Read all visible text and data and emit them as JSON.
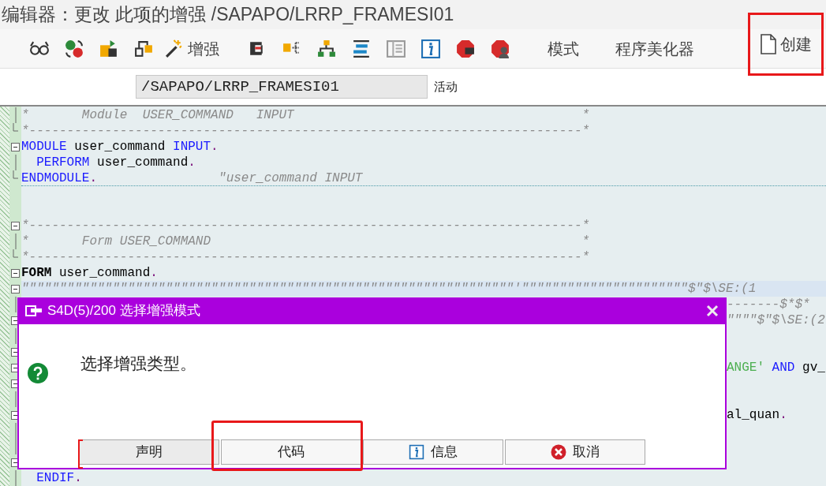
{
  "window": {
    "title": "编辑器：更改 此项的增强 /SAPAPO/LRRP_FRAMESI01"
  },
  "toolbar": [
    {
      "kind": "icon"
    },
    {
      "kind": "icon"
    },
    {
      "kind": "icon"
    },
    {
      "kind": "icon"
    },
    {
      "kind": "icon_text",
      "label": "增强"
    },
    {
      "kind": "icon"
    },
    {
      "kind": "icon"
    },
    {
      "kind": "icon"
    },
    {
      "kind": "icon"
    },
    {
      "kind": "icon"
    },
    {
      "kind": "icon"
    },
    {
      "kind": "icon"
    },
    {
      "kind": "icon"
    },
    {
      "kind": "text",
      "label": "模式"
    },
    {
      "kind": "text",
      "label": "程序美化器"
    },
    {
      "kind": "icon_text",
      "label": "创建",
      "highlighted": true
    }
  ],
  "object_field": {
    "value": "/SAPAPO/LRRP_FRAMESI01",
    "status": "活动"
  },
  "editor": {
    "lines": [
      {
        "fold": {
          "kind": "line"
        },
        "segments": [
          {
            "kind": "comment",
            "text": "*       Module  USER_COMMAND   INPUT                                      *"
          }
        ]
      },
      {
        "fold": {
          "kind": "end"
        },
        "segments": [
          {
            "kind": "comment",
            "text": "*-------------------------------------------------------------------------*"
          }
        ]
      },
      {
        "fold": {
          "kind": "open"
        },
        "segments": [
          {
            "kind": "keyword",
            "text": "MODULE"
          },
          {
            "kind": "plain",
            "text": " user_command "
          },
          {
            "kind": "keyword",
            "text": "INPUT"
          },
          {
            "kind": "punct",
            "text": "."
          }
        ]
      },
      {
        "fold": {
          "kind": "line"
        },
        "segments": [
          {
            "kind": "keyword",
            "text": "  PERFORM"
          },
          {
            "kind": "plain",
            "text": " user_command"
          },
          {
            "kind": "punct",
            "text": "."
          }
        ]
      },
      {
        "fold": {
          "kind": "end"
        },
        "separator": true,
        "segments": [
          {
            "kind": "keyword",
            "text": "ENDMODULE"
          },
          {
            "kind": "punct",
            "text": "."
          },
          {
            "kind": "end_comment",
            "text": "\"user_command INPUT"
          }
        ]
      },
      {
        "fold": {
          "kind": "open"
        },
        "gap_before": true,
        "segments": [
          {
            "kind": "comment",
            "text": "*-------------------------------------------------------------------------*"
          }
        ]
      },
      {
        "fold": {
          "kind": "line"
        },
        "segments": [
          {
            "kind": "comment",
            "text": "*       Form USER_COMMAND                                                 *"
          }
        ]
      },
      {
        "fold": {
          "kind": "end"
        },
        "segments": [
          {
            "kind": "comment",
            "text": "*-------------------------------------------------------------------------*"
          }
        ]
      },
      {
        "fold": {
          "kind": "open"
        },
        "segments": [
          {
            "kind": "bold",
            "text": "FORM"
          },
          {
            "kind": "plain",
            "text": " user_command"
          },
          {
            "kind": "punct",
            "text": "."
          }
        ]
      },
      {
        "fold": {
          "kind": "open"
        },
        "current": true,
        "segments": [
          {
            "kind": "comment",
            "text": "\"\"\"\"\"\"\"\"\"\"\"\"\"\"\"\"\"\"\"\"\"\"\"\"\"\"\"\"\"\"\"\"\"\"\"\"\"\"\"\"\"\"\"\"\"\"\"\"\"\"\"\"\"\"\"\"\"\"\"\"\"\"\"\"\"'\"\"\"\"\"\"\"\"\"\"\"\"\"\"\"\"\"\"\"\"\"\"$\"$\\SE:(1"
          }
        ]
      },
      {
        "fold": {
          "kind": "line"
        },
        "tail": true,
        "segments": [
          {
            "kind": "comment",
            "text": "-------$*$*"
          }
        ]
      },
      {
        "fold": {
          "kind": "open"
        },
        "tail": true,
        "segments": [
          {
            "kind": "comment",
            "text": "\"\"\"\"$\"$\\SE:(2"
          }
        ]
      },
      {
        "fold": {
          "kind": "line"
        }
      },
      {
        "fold": {
          "kind": "open"
        }
      },
      {
        "fold": {
          "kind": "open"
        },
        "tail": true,
        "segments": [
          {
            "kind": "string",
            "text": "ANGE'"
          },
          {
            "kind": "keyword",
            "text": " AND"
          },
          {
            "kind": "plain",
            "text": " gv_"
          }
        ]
      },
      {
        "fold": {
          "kind": "open"
        }
      },
      {
        "fold": {
          "kind": "line"
        }
      },
      {
        "fold": {
          "kind": "open"
        },
        "tail": true,
        "segments": [
          {
            "kind": "plain",
            "text": "al_quan"
          },
          {
            "kind": "punct",
            "text": "."
          }
        ]
      },
      {
        "fold": {
          "kind": "line"
        }
      },
      {
        "fold": {
          "kind": "line"
        }
      },
      {
        "fold": {
          "kind": "open"
        }
      },
      {
        "fold": {
          "kind": "line"
        },
        "segments": [
          {
            "kind": "keyword",
            "text": "  ENDIF"
          },
          {
            "kind": "punct",
            "text": "."
          }
        ]
      }
    ]
  },
  "dialog": {
    "title": "S4D(5)/200 选择增强模式",
    "message": "选择增强类型。",
    "buttons": [
      {
        "kind": "plain",
        "label": "声明",
        "highlighted": false
      },
      {
        "kind": "plain",
        "label": "代码",
        "highlighted": true
      },
      {
        "kind": "info",
        "label": "信息",
        "highlighted": false
      },
      {
        "kind": "cancel",
        "label": "取消",
        "highlighted": false
      }
    ]
  }
}
